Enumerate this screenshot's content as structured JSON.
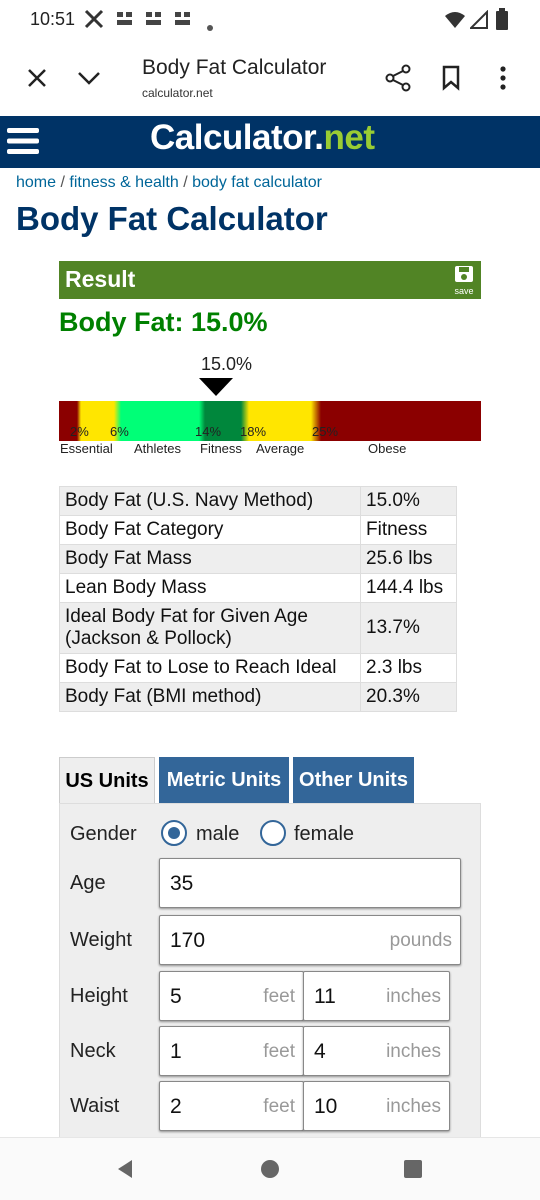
{
  "status_bar": {
    "time": "10:51",
    "icons": [
      "x-app-icon",
      "notification-icon",
      "notification-icon",
      "notification-icon",
      "dot-icon",
      "wifi-icon",
      "signal-icon",
      "battery-icon"
    ]
  },
  "browser": {
    "title": "Body Fat Calculator",
    "url": "calculator.net",
    "icons": [
      "close-icon",
      "chevron-down-icon",
      "share-icon",
      "bookmark-icon",
      "more-icon"
    ]
  },
  "site": {
    "logo_main": "Calculator",
    "logo_dot": ".",
    "logo_tld": "net",
    "menu_icon": "hamburger-menu-icon",
    "colors": {
      "header": "#003366",
      "accent_green": "#99cc33"
    }
  },
  "breadcrumb": {
    "home": "home",
    "sep": " / ",
    "fitness": "fitness & health",
    "current": "body fat calculator"
  },
  "page_title": "Body Fat Calculator",
  "result": {
    "header": "Result",
    "save_label": "save",
    "headline": "Body Fat: 15.0%",
    "gauge": {
      "marker_label": "15.0%",
      "marker_value": 15.0,
      "ticks": [
        "2%",
        "6%",
        "14%",
        "18%",
        "25%"
      ],
      "categories": [
        "Essential",
        "Athletes",
        "Fitness",
        "Average",
        "Obese"
      ]
    },
    "table": [
      {
        "label": "Body Fat (U.S. Navy Method)",
        "value": "15.0%"
      },
      {
        "label": "Body Fat Category",
        "value": "Fitness"
      },
      {
        "label": "Body Fat Mass",
        "value": "25.6 lbs"
      },
      {
        "label": "Lean Body Mass",
        "value": "144.4 lbs"
      },
      {
        "label": "Ideal Body Fat for Given Age (Jackson & Pollock)",
        "value": "13.7%"
      },
      {
        "label": "Body Fat to Lose to Reach Ideal",
        "value": "2.3 lbs"
      },
      {
        "label": "Body Fat (BMI method)",
        "value": "20.3%"
      }
    ]
  },
  "tabs": [
    "US Units",
    "Metric Units",
    "Other Units"
  ],
  "form": {
    "gender": {
      "label": "Gender",
      "options": [
        "male",
        "female"
      ],
      "selected": "male"
    },
    "age": {
      "label": "Age",
      "value": "35"
    },
    "weight": {
      "label": "Weight",
      "value": "170",
      "unit": "pounds"
    },
    "height": {
      "label": "Height",
      "feet": "5",
      "feet_unit": "feet",
      "inches": "11",
      "inches_unit": "inches"
    },
    "neck": {
      "label": "Neck",
      "feet": "1",
      "feet_unit": "feet",
      "inches": "4",
      "inches_unit": "inches"
    },
    "waist": {
      "label": "Waist",
      "feet": "2",
      "feet_unit": "feet",
      "inches": "10",
      "inches_unit": "inches"
    }
  }
}
